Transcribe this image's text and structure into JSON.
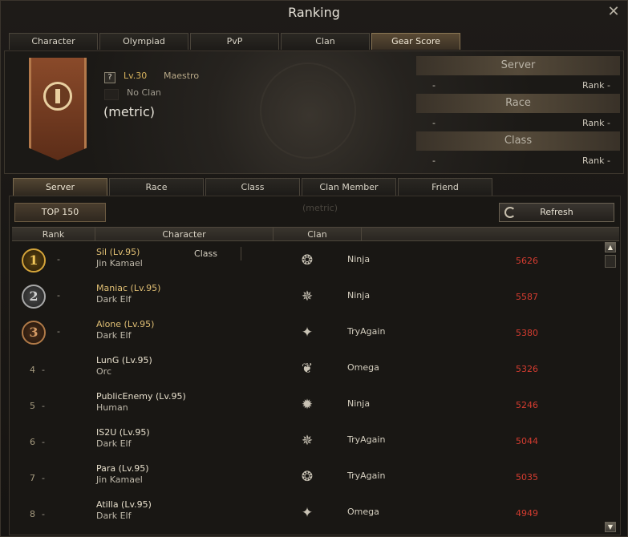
{
  "window": {
    "title": "Ranking",
    "close_icon": "close-icon"
  },
  "main_tabs": [
    {
      "label": "Character",
      "active": false
    },
    {
      "label": "Olympiad",
      "active": false
    },
    {
      "label": "PvP",
      "active": false
    },
    {
      "label": "Clan",
      "active": false
    },
    {
      "label": "Gear Score",
      "active": true
    }
  ],
  "profile": {
    "level": "Lv.30",
    "class": "Maestro",
    "clan": "No Clan",
    "name": "(metric)",
    "help_icon": "?",
    "stats": [
      {
        "title": "Server",
        "value": "-",
        "rank_label": "Rank",
        "rank_value": "-"
      },
      {
        "title": "Race",
        "value": "-",
        "rank_label": "Rank",
        "rank_value": "-"
      },
      {
        "title": "Class",
        "value": "-",
        "rank_label": "Rank",
        "rank_value": "-"
      }
    ]
  },
  "sub_tabs": [
    {
      "label": "Server",
      "active": true
    },
    {
      "label": "Race",
      "active": false
    },
    {
      "label": "Class",
      "active": false
    },
    {
      "label": "Clan Member",
      "active": false
    },
    {
      "label": "Friend",
      "active": false
    }
  ],
  "controls": {
    "top_label": "TOP 150",
    "ghost_name": "(metric)",
    "refresh_label": "Refresh"
  },
  "table": {
    "headers": {
      "rank": "Rank",
      "character": "Character",
      "class": "Class",
      "clan": "Clan"
    },
    "rows": [
      {
        "rank": "1",
        "change": "-",
        "name": "Sil (Lv.95)",
        "race": "Jin Kamael",
        "class_icon": "seal-icon",
        "clan": "Ninja",
        "score": "5626"
      },
      {
        "rank": "2",
        "change": "-",
        "name": "Maniac (Lv.95)",
        "race": "Dark Elf",
        "class_icon": "wing-crest-icon",
        "clan": "Ninja",
        "score": "5587"
      },
      {
        "rank": "3",
        "change": "-",
        "name": "Alone (Lv.95)",
        "race": "Dark Elf",
        "class_icon": "star-crest-icon",
        "clan": "TryAgain",
        "score": "5380"
      },
      {
        "rank": "4",
        "change": "-",
        "name": "LunG (Lv.95)",
        "race": "Orc",
        "class_icon": "beast-crest-icon",
        "clan": "Omega",
        "score": "5326"
      },
      {
        "rank": "5",
        "change": "-",
        "name": "PublicEnemy (Lv.95)",
        "race": "Human",
        "class_icon": "sun-crest-icon",
        "clan": "Ninja",
        "score": "5246"
      },
      {
        "rank": "6",
        "change": "-",
        "name": "IS2U (Lv.95)",
        "race": "Dark Elf",
        "class_icon": "wing-crest-icon",
        "clan": "TryAgain",
        "score": "5044"
      },
      {
        "rank": "7",
        "change": "-",
        "name": "Para (Lv.95)",
        "race": "Jin Kamael",
        "class_icon": "seal-icon",
        "clan": "TryAgain",
        "score": "5035"
      },
      {
        "rank": "8",
        "change": "-",
        "name": "Atilla (Lv.95)",
        "race": "Dark Elf",
        "class_icon": "star-crest-icon",
        "clan": "Omega",
        "score": "4949"
      }
    ]
  }
}
